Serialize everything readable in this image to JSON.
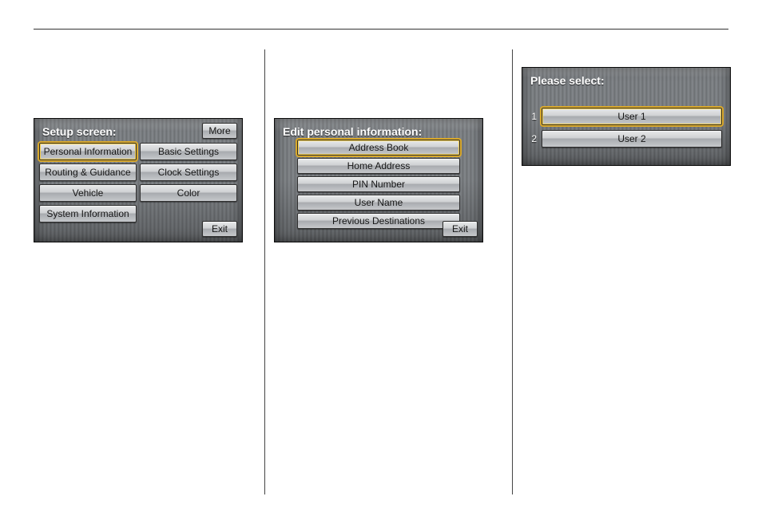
{
  "setup": {
    "title": "Setup screen:",
    "more": "More",
    "exit": "Exit",
    "buttons": {
      "personal_information": "Personal Information",
      "basic_settings": "Basic Settings",
      "routing_guidance": "Routing & Guidance",
      "clock_settings": "Clock Settings",
      "vehicle": "Vehicle",
      "color": "Color",
      "system_information": "System Information"
    }
  },
  "edit": {
    "title": "Edit personal information:",
    "exit": "Exit",
    "items": {
      "address_book": "Address Book",
      "home_address": "Home Address",
      "pin_number": "PIN Number",
      "user_name": "User Name",
      "previous_destinations": "Previous Destinations"
    }
  },
  "select": {
    "title": "Please select:",
    "rows": {
      "r1_num": "1",
      "r1_label": "User 1",
      "r2_num": "2",
      "r2_label": "User 2"
    }
  }
}
